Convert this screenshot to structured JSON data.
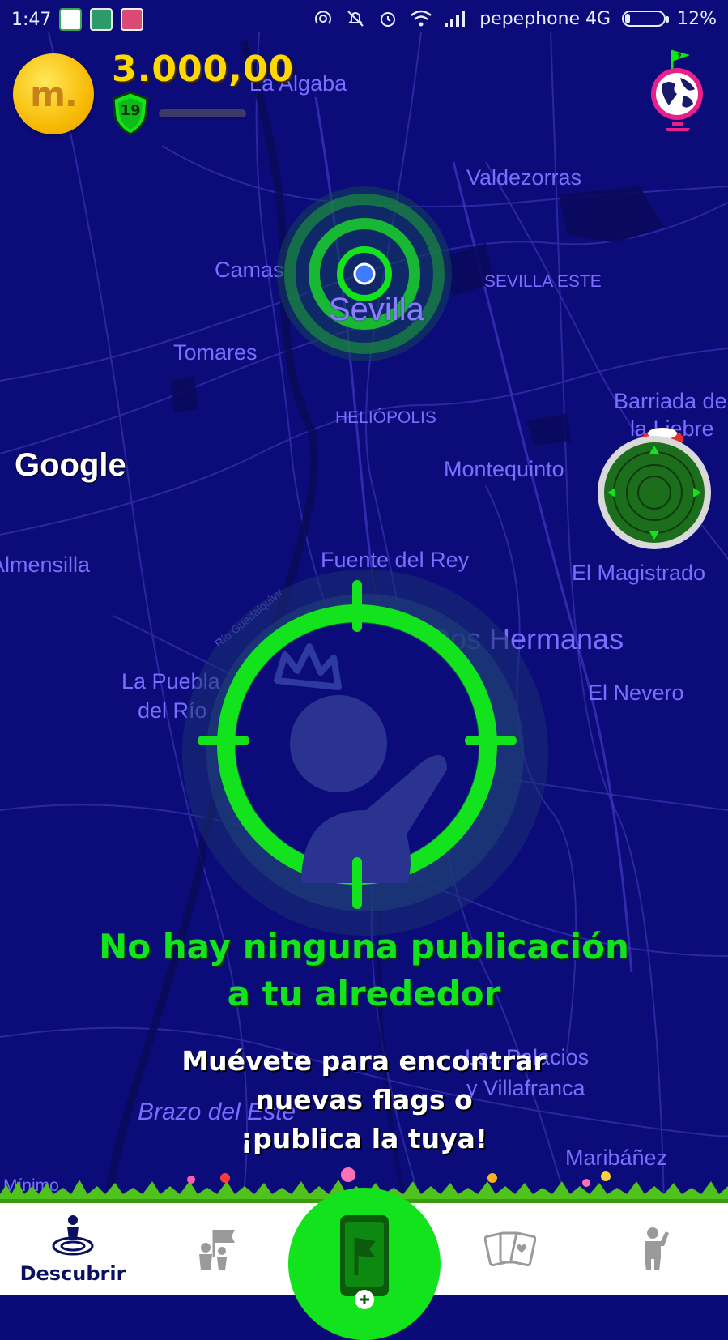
{
  "status_bar": {
    "time": "1:47",
    "carrier": "pepephone 4G",
    "battery": "12%",
    "battery_level": 0.12,
    "icons": [
      "hotspot-icon",
      "silent-icon",
      "alarm-icon",
      "wifi-icon",
      "signal-icon"
    ],
    "apps": [
      "google-app-icon",
      "android-app-icon",
      "calendar-app-icon"
    ]
  },
  "header": {
    "coin_symbol": "m.",
    "coins": "3.000,00",
    "level": "19",
    "xp_progress": 0.0,
    "globe_icon": "globe-flag-icon"
  },
  "map": {
    "attribution": "Google",
    "places": {
      "la_algaba": "La Algaba",
      "valdezorras": "Valdezorras",
      "camas": "Camas",
      "sevilla": "Sevilla",
      "sevilla_este": "SEVILLA ESTE",
      "tomares": "Tomares",
      "heliopolis": "HELIÓPOLIS",
      "barriada_line1": "Barriada de",
      "barriada_line2": "la Liebre",
      "montequinto": "Montequinto",
      "almensilla": "Almensilla",
      "fuente_del_rey": "Fuente del Rey",
      "el_magistrado": "El Magistrado",
      "rio": "Río Guadalquivir",
      "dos_hermanas": "Dos Hermanas",
      "la_puebla_line1": "La Puebla",
      "la_puebla_line2": "del Río",
      "el_nevero": "El Nevero",
      "los_palacios_line1": "Los Palacios",
      "los_palacios_line2": "y Villafranca",
      "brazo_del_este": "Brazo del Este",
      "maribanez": "Maribáñez",
      "minimo": "Mínimo"
    }
  },
  "empty_state": {
    "title_line1": "No hay ninguna publicación",
    "title_line2": "a tu alrededor",
    "subtitle_line1": "Muévete para encontrar",
    "subtitle_line2": "nuevas flags o",
    "subtitle_line3": "¡publica la tuya!"
  },
  "bottom_nav": {
    "discover_label": "Descubrir",
    "items": [
      "discover-icon",
      "flag-people-icon",
      "new-flag-icon",
      "cards-icon",
      "profile-icon"
    ]
  },
  "colors": {
    "map_background": "#0b0c7a",
    "accent_green": "#12e31c",
    "coin_yellow": "#ffd800",
    "place_label": "#7a6dff"
  }
}
